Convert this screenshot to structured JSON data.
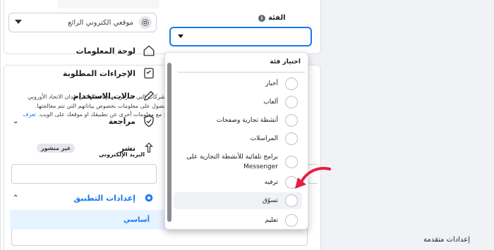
{
  "sidebar": {
    "site_selector": "موقعي الكتروني الرائع",
    "items": [
      {
        "label": "لوحة المعلومات"
      },
      {
        "label": "الإجراءات المطلوبة"
      },
      {
        "label": "حالات الاستخدام"
      },
      {
        "label": "مراجعة"
      },
      {
        "label": "نشر",
        "badge": "غير منشور"
      },
      {
        "label": "إعدادات التطبيق"
      }
    ],
    "active_sub": "أساسي",
    "sub2": "إعدادات متقدمة"
  },
  "main": {
    "category_label": "الفئة",
    "info_glyph": "i",
    "body_lines": [
      "لشركات التي تمارس مهام أعمالها في بلدان الاتحاد الأوروبي",
      "حصول على معلومات بخصوص بياناتهم التي تتم معالجتها.",
      "ج مع معلومات أخرى عن تطبيقك او موقعك على الويب."
    ],
    "body_link": "تعرف",
    "email_label": "البريد الإلكتروني"
  },
  "dropdown": {
    "header": "اختيار فئة",
    "options": [
      "أخبار",
      "ألعاب",
      "أنشطة تجارية وصفحات",
      "المراسلات",
      "برامج تلقائية للأنشطة التجارية على Messenger",
      "ترفيه",
      "تسوّق",
      "تعليم"
    ]
  },
  "colors": {
    "accent": "#1877f2",
    "arrow": "#e41e3f"
  }
}
